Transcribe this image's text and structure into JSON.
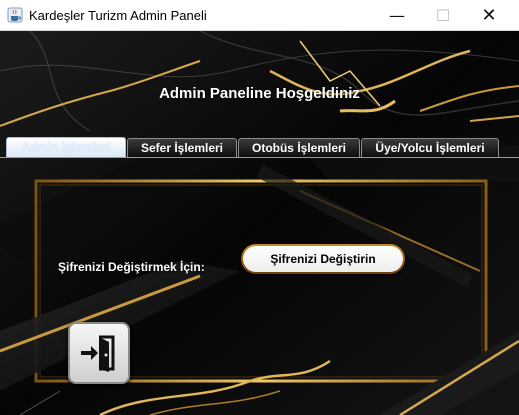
{
  "window": {
    "title": "Kardeşler Turizm Admin Paneli",
    "minimize_glyph": "—",
    "maximize_glyph": "☐",
    "close_glyph": "✕",
    "app_icon": "java-cup-icon"
  },
  "heading": "Admin Paneline Hoşgeldiniz",
  "tabs": [
    {
      "label": "Admin İşlemleri",
      "active": true
    },
    {
      "label": "Sefer İşlemleri",
      "active": false
    },
    {
      "label": "Otobüs İşlemleri",
      "active": false
    },
    {
      "label": "Üye/Yolcu İşlemleri",
      "active": false
    }
  ],
  "admin_tab": {
    "password_label": "Şifrenizi Değiştirmek İçin:",
    "password_button": "Şifrenizi Değiştirin",
    "exit_icon": "exit-door-icon"
  },
  "colors": {
    "gold": "#c9972f",
    "background": "#0a0a0a",
    "active_tab": "#dbe8f5"
  }
}
